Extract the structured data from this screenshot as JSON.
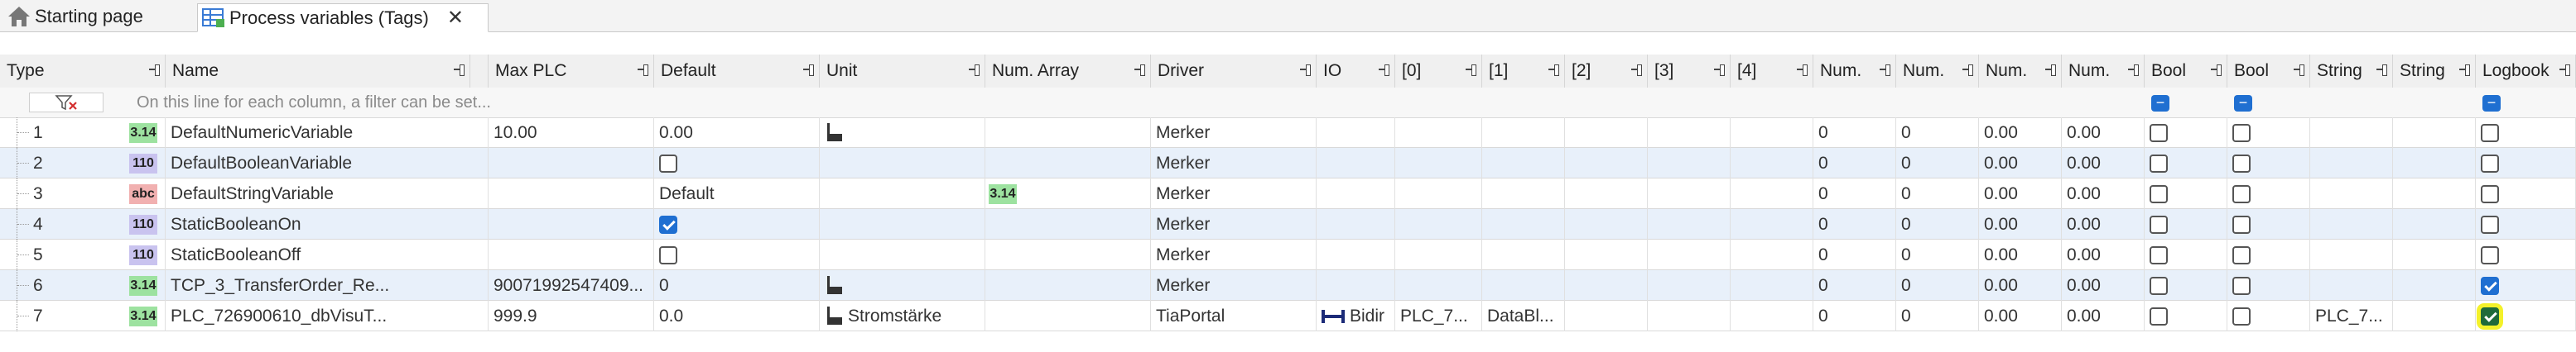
{
  "tabs": [
    {
      "label": "Starting page",
      "icon": "home-icon"
    },
    {
      "label": "Process variables (Tags)",
      "icon": "table-icon",
      "close": "✕"
    }
  ],
  "columns": [
    "Type",
    "Name",
    "",
    "Max PLC",
    "Default",
    "Unit",
    "Num. Array",
    "Driver",
    "IO",
    "[0]",
    "[1]",
    "[2]",
    "[3]",
    "[4]",
    "Num.",
    "Num.",
    "Num.",
    "Num.",
    "Bool",
    "Bool",
    "String",
    "String",
    "Logbook"
  ],
  "filter_row": {
    "hint": "On this line for each column, a filter can be set..."
  },
  "rows": [
    {
      "num": "1",
      "type": "3.14",
      "name": "DefaultNumericVariable",
      "max": "10.00",
      "default": "0.00",
      "default_type": "text",
      "unit": "",
      "unit_icon": true,
      "numarray": "",
      "driver": "Merker",
      "io": "",
      "a0": "",
      "a1": "",
      "n1": "0",
      "n2": "0",
      "n3": "0.00",
      "n4": "0.00",
      "b1": false,
      "b2": false,
      "s1": "",
      "logbook": false
    },
    {
      "num": "2",
      "type": "110",
      "name": "DefaultBooleanVariable",
      "max": "",
      "default": "",
      "default_type": "checkbox",
      "default_checked": false,
      "unit": "",
      "unit_icon": false,
      "numarray": "",
      "driver": "Merker",
      "io": "",
      "a0": "",
      "a1": "",
      "n1": "0",
      "n2": "0",
      "n3": "0.00",
      "n4": "0.00",
      "b1": false,
      "b2": false,
      "s1": "",
      "logbook": false
    },
    {
      "num": "3",
      "type": "abc",
      "name": "DefaultStringVariable",
      "max": "",
      "default": "Default",
      "default_type": "text",
      "unit": "",
      "unit_icon": false,
      "numarray": "3.14",
      "driver": "Merker",
      "io": "",
      "a0": "",
      "a1": "",
      "n1": "0",
      "n2": "0",
      "n3": "0.00",
      "n4": "0.00",
      "b1": false,
      "b2": false,
      "s1": "",
      "logbook": false
    },
    {
      "num": "4",
      "type": "110",
      "name": "StaticBooleanOn",
      "max": "",
      "default": "",
      "default_type": "checkbox",
      "default_checked": true,
      "unit": "",
      "unit_icon": false,
      "numarray": "",
      "driver": "Merker",
      "io": "",
      "a0": "",
      "a1": "",
      "n1": "0",
      "n2": "0",
      "n3": "0.00",
      "n4": "0.00",
      "b1": false,
      "b2": false,
      "s1": "",
      "logbook": false
    },
    {
      "num": "5",
      "type": "110",
      "name": "StaticBooleanOff",
      "max": "",
      "default": "",
      "default_type": "checkbox",
      "default_checked": false,
      "unit": "",
      "unit_icon": false,
      "numarray": "",
      "driver": "Merker",
      "io": "",
      "a0": "",
      "a1": "",
      "n1": "0",
      "n2": "0",
      "n3": "0.00",
      "n4": "0.00",
      "b1": false,
      "b2": false,
      "s1": "",
      "logbook": false
    },
    {
      "num": "6",
      "type": "3.14",
      "name": "TCP_3_TransferOrder_Re...",
      "max": "90071992547409...",
      "default": "0",
      "default_type": "text",
      "unit": "",
      "unit_icon": true,
      "numarray": "",
      "driver": "Merker",
      "io": "",
      "a0": "",
      "a1": "",
      "n1": "0",
      "n2": "0",
      "n3": "0.00",
      "n4": "0.00",
      "b1": false,
      "b2": false,
      "s1": "",
      "logbook": true
    },
    {
      "num": "7",
      "type": "3.14",
      "name": "PLC_726900610_dbVisuT...",
      "max": "999.9",
      "default": "0.0",
      "default_type": "text",
      "unit": "Stromstärke",
      "unit_icon": true,
      "numarray": "",
      "driver": "TiaPortal",
      "io": "Bidir",
      "a0": "PLC_7...",
      "a1": "DataBl...",
      "n1": "0",
      "n2": "0",
      "n3": "0.00",
      "n4": "0.00",
      "b1": false,
      "b2": false,
      "s1": "PLC_7...",
      "logbook": true,
      "logbook_highlight": true
    }
  ],
  "colors": {
    "alt_row": "#e8f0fa",
    "checked": "#1f6fd1",
    "highlight": "#f4f12a",
    "badge_num": "#9de2a0",
    "badge_bool": "#c9c3ef",
    "badge_str": "#f1b0b0"
  }
}
